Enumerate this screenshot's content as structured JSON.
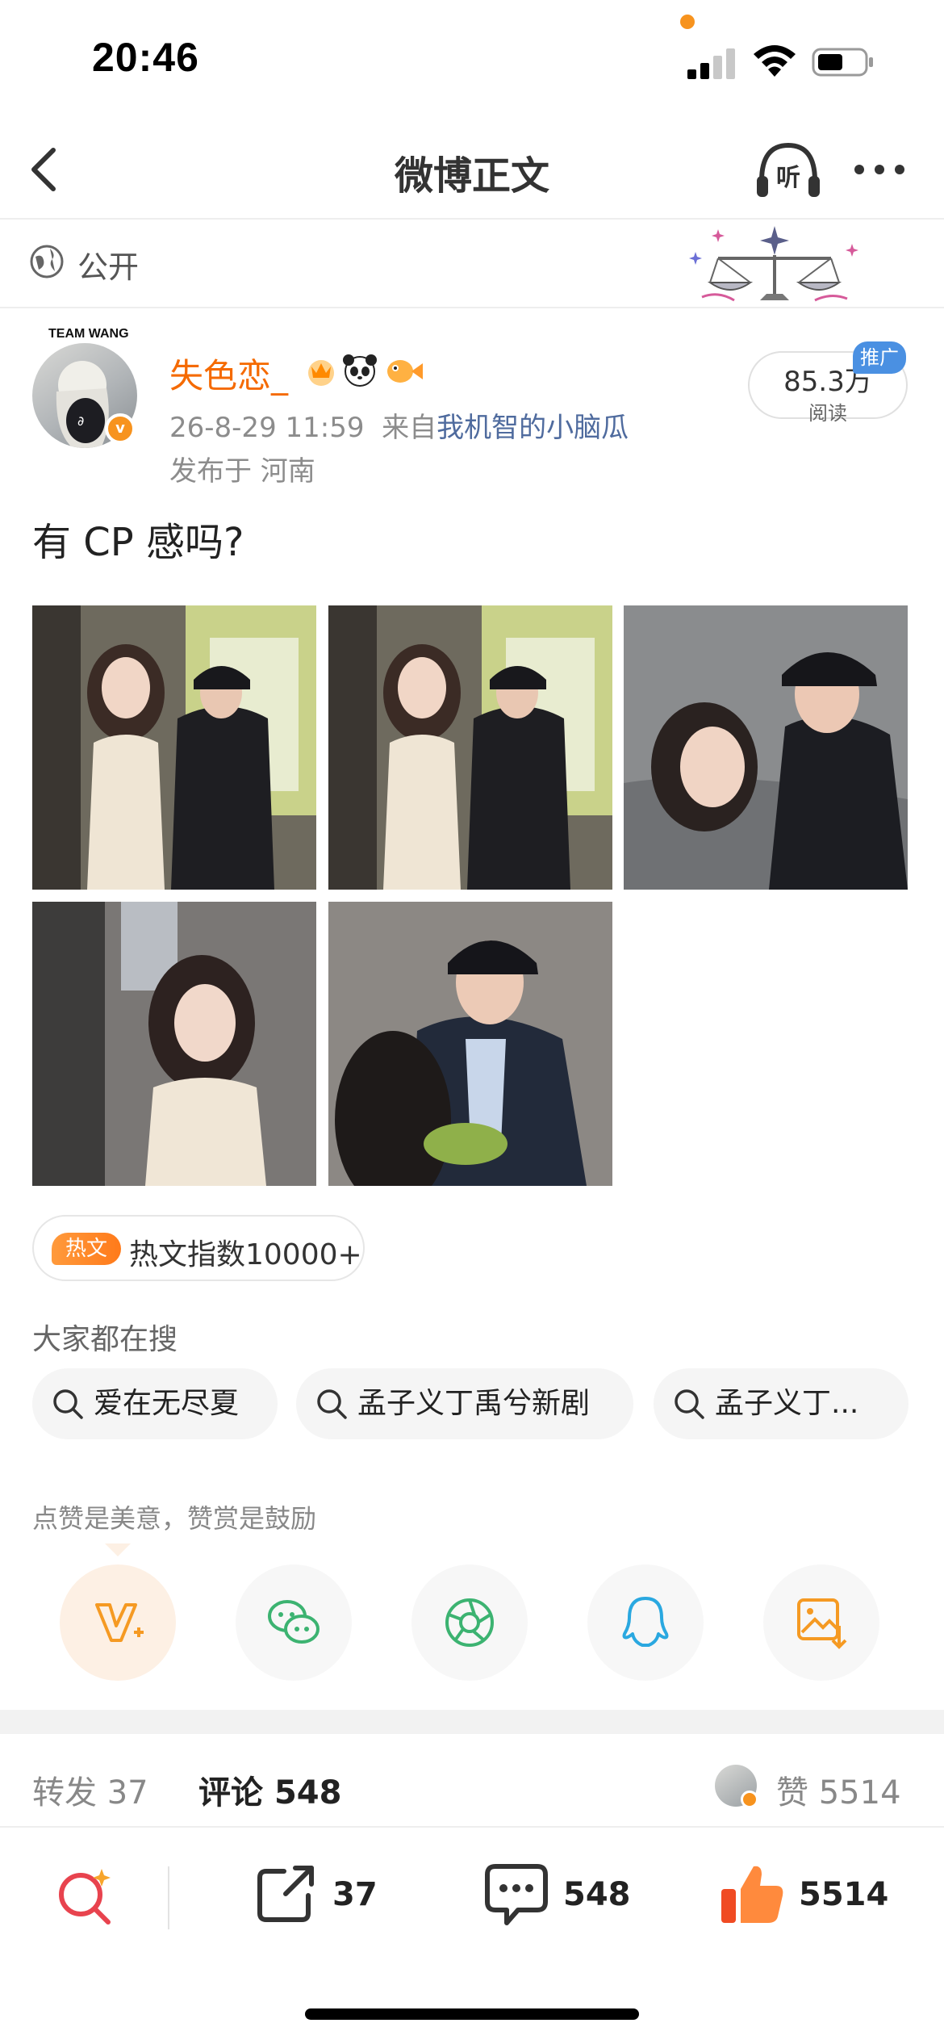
{
  "status_bar": {
    "time": "20:46"
  },
  "nav": {
    "title": "微博正文",
    "listen_label": "听"
  },
  "visibility": {
    "label": "公开"
  },
  "author": {
    "name": "失色恋_",
    "avatar_text": "TEAM WANG",
    "timestamp": "26-8-29 11:59",
    "source_prefix": "来自",
    "source": "我机智的小脑瓜",
    "location": "发布于 河南",
    "verified_color": "#f7931e"
  },
  "read_count": {
    "value": "85.3万",
    "label": "阅读",
    "promo_tag": "推广"
  },
  "post": {
    "text": "有 CP 感吗?"
  },
  "images": [
    {
      "name": "photo-1",
      "scene": "couple-seated-street"
    },
    {
      "name": "photo-2",
      "scene": "couple-seated-street"
    },
    {
      "name": "photo-3",
      "scene": "couple-closeup-cap"
    },
    {
      "name": "photo-4",
      "scene": "woman-closeup"
    },
    {
      "name": "photo-5",
      "scene": "man-eating-smiling"
    }
  ],
  "hot": {
    "tag": "热文",
    "text": "热文指数10000+"
  },
  "search": {
    "title": "大家都在搜",
    "chips": [
      "爱在无尽夏",
      "孟子义丁禹兮新剧",
      "孟子义丁..."
    ]
  },
  "reward": {
    "text": "点赞是美意，赞赏是鼓励"
  },
  "share_targets": [
    "reward-icon",
    "wechat-icon",
    "moments-icon",
    "qq-icon",
    "save-image-icon"
  ],
  "tabs": {
    "repost_label": "转发",
    "repost_count": "37",
    "comment_label": "评论",
    "comment_count": "548",
    "like_label": "赞",
    "like_count": "5514"
  },
  "bottom_bar": {
    "repost_count": "37",
    "comment_count": "548",
    "like_count": "5514"
  },
  "colors": {
    "accent_orange": "#f56a00",
    "link_blue": "#4f6b9e",
    "promo_blue": "#4a90e2",
    "wechat_green": "#3cb371",
    "qq_blue": "#2aa8e0"
  }
}
